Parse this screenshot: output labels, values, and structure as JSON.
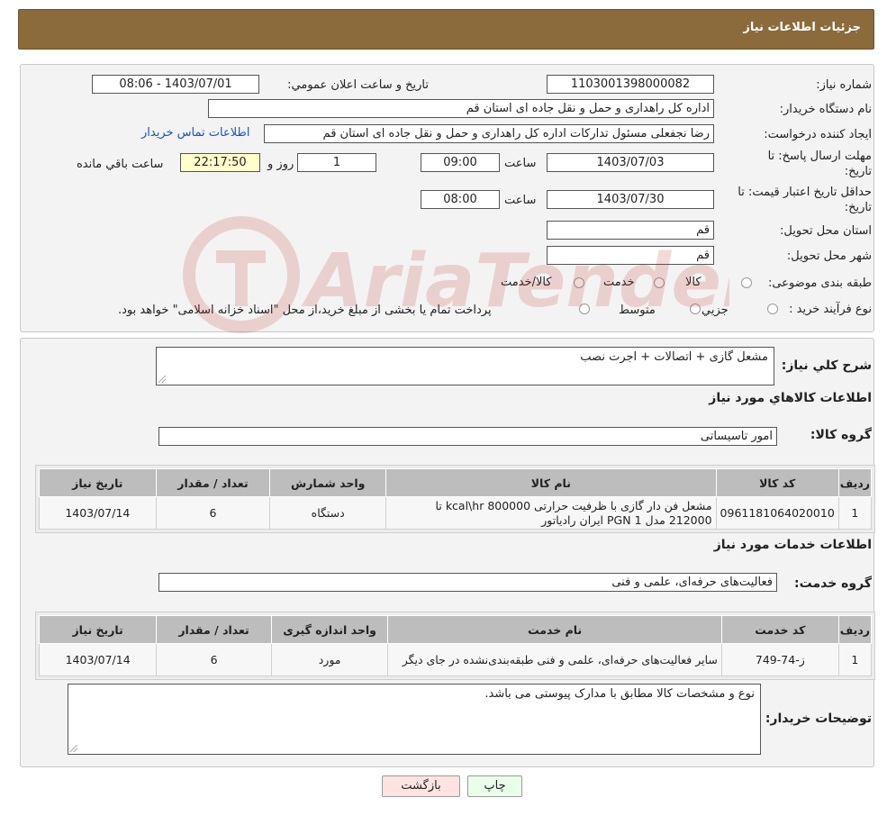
{
  "header": {
    "title": "جزئیات اطلاعات نیاز"
  },
  "info": {
    "need_number_label": "شماره نیاز:",
    "need_number": "1103001398000082",
    "announce_label": "تاریخ و ساعت اعلان عمومي:",
    "announce_value": "1403/07/01 - 08:06",
    "buyer_org_label": "نام دستگاه خريدار:",
    "buyer_org": "اداره کل راهداری و حمل و نقل جاده ای استان قم",
    "creator_label": "ايجاد کننده درخواست:",
    "creator": "رضا  نجفعلی مسئول تدارکات اداره کل راهداری و حمل و نقل جاده ای استان قم",
    "contact_link": "اطلاعات تماس خريدار",
    "deadline_label_1": "مهلت ارسال پاسخ: تا",
    "deadline_label_2": "تاریخ:",
    "deadline_date": "1403/07/03",
    "time_label": "ساعت",
    "deadline_time": "09:00",
    "days": "1",
    "days_label": "روز و",
    "remaining_time": "22:17:50",
    "remaining_label": "ساعت باقي مانده",
    "validity_label_1": "حداقل تاريخ اعتبار قيمت: تا",
    "validity_label_2": "تاريخ:",
    "validity_date": "1403/07/30",
    "validity_time_label": "ساعت",
    "validity_time": "08:00",
    "province_label": "استان محل تحويل:",
    "province": "قم",
    "city_label": "شهر محل تحويل:",
    "city": "قم",
    "category_label": "طبقه بندی موضوعی:",
    "category_options": [
      "کالا",
      "خدمت",
      "کالا/خدمت"
    ],
    "process_label": "نوع فرآيند خريد :",
    "process_options": [
      "جزيي",
      "متوسط"
    ],
    "process_note": "پرداخت تمام يا بخشی از مبلغ خريد،از محل \"اسناد خزانه اسلامی\" خواهد بود."
  },
  "details": {
    "desc_label": "شرح کلي نياز:",
    "desc_value": "مشعل گازی + اتصالات + اجرت نصب",
    "goods_section_title": "اطلاعات کالاهاي مورد نياز",
    "goods_group_label": "گروه کالا:",
    "goods_group_value": "امور تاسیساتی",
    "goods_table": {
      "headers": [
        "رديف",
        "کد کالا",
        "نام کالا",
        "واحد شمارش",
        "تعداد / مقدار",
        "تاريخ نياز"
      ],
      "rows": [
        [
          "1",
          "0961181064020010",
          "مشعل فن دار گازی با ظرفیت حرارتی 800000 kcal\\hr تا 212000 مدل PGN 1 ایران رادیاتور",
          "دستگاه",
          "6",
          "1403/07/14"
        ]
      ]
    },
    "services_section_title": "اطلاعات خدمات مورد نياز",
    "service_group_label": "گروه خدمت:",
    "service_group_value": "فعالیت‌های حرفه‌ای، علمی و فنی",
    "service_table": {
      "headers": [
        "رديف",
        "کد خدمت",
        "نام خدمت",
        "واحد اندازه گيری",
        "تعداد / مقدار",
        "تاريخ نياز"
      ],
      "rows": [
        [
          "1",
          "ز-74-749",
          "سایر فعالیت‌های حرفه‌ای، علمی و فنی طبقه‌بندی‌نشده در جای دیگر",
          "مورد",
          "6",
          "1403/07/14"
        ]
      ]
    },
    "buyer_notes_label": "توضيحات خريدار:",
    "buyer_notes_value": "نوع و مشخصات کالا مطابق با مدارک پیوستی می باشد."
  },
  "buttons": {
    "print": "چاپ",
    "back": "بازگشت"
  },
  "watermark": {
    "text": "AriaTender.neT",
    "color": "#c0392b"
  },
  "colors": {
    "header_bg": "#8b6a3c",
    "link": "#1155cc",
    "print_bg": "#eaffea",
    "back_bg": "#ffe3e3"
  }
}
